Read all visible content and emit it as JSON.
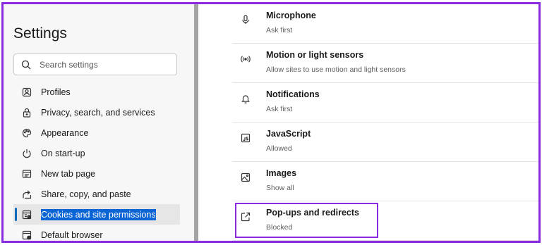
{
  "sidebar": {
    "title": "Settings",
    "search_placeholder": "Search settings",
    "items": [
      {
        "label": "Profiles",
        "icon": "profile-icon"
      },
      {
        "label": "Privacy, search, and services",
        "icon": "lock-icon"
      },
      {
        "label": "Appearance",
        "icon": "palette-icon"
      },
      {
        "label": "On start-up",
        "icon": "power-icon"
      },
      {
        "label": "New tab page",
        "icon": "new-tab-icon"
      },
      {
        "label": "Share, copy, and paste",
        "icon": "share-icon"
      },
      {
        "label": "Cookies and site permissions",
        "icon": "cookies-icon",
        "active": true
      },
      {
        "label": "Default browser",
        "icon": "browser-icon"
      }
    ]
  },
  "permissions": [
    {
      "title": "Microphone",
      "subtitle": "Ask first",
      "icon": "microphone-icon"
    },
    {
      "title": "Motion or light sensors",
      "subtitle": "Allow sites to use motion and light sensors",
      "icon": "sensor-icon"
    },
    {
      "title": "Notifications",
      "subtitle": "Ask first",
      "icon": "bell-icon"
    },
    {
      "title": "JavaScript",
      "subtitle": "Allowed",
      "icon": "javascript-icon"
    },
    {
      "title": "Images",
      "subtitle": "Show all",
      "icon": "image-icon"
    },
    {
      "title": "Pop-ups and redirects",
      "subtitle": "Blocked",
      "icon": "popup-icon",
      "highlighted": true
    }
  ],
  "colors": {
    "accent": "#0f6cbd",
    "selection": "#0a64d6",
    "highlight_border": "#8a2be2",
    "divider": "#a3a3a3"
  }
}
